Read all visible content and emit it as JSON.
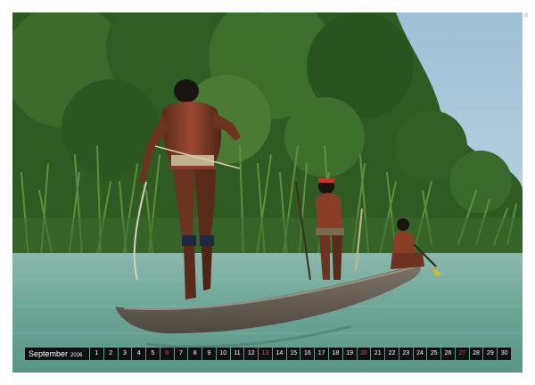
{
  "calendar": {
    "month": "September",
    "year": "2026",
    "days": [
      "1",
      "2",
      "3",
      "4",
      "5",
      "6",
      "7",
      "8",
      "9",
      "10",
      "11",
      "12",
      "13",
      "14",
      "15",
      "16",
      "17",
      "18",
      "19",
      "20",
      "21",
      "22",
      "23",
      "24",
      "25",
      "26",
      "27",
      "28",
      "29",
      "30"
    ],
    "highlighted_days": [
      "6",
      "13",
      "20",
      "27"
    ],
    "highlight_color": "#e05040",
    "strip_color": "#101010"
  },
  "photo": {
    "sky_color": "#a9c6d8",
    "water_color": "#6ea9a0",
    "foliage_color": "#3d6b2c",
    "canoe_color": "#6a6258"
  }
}
